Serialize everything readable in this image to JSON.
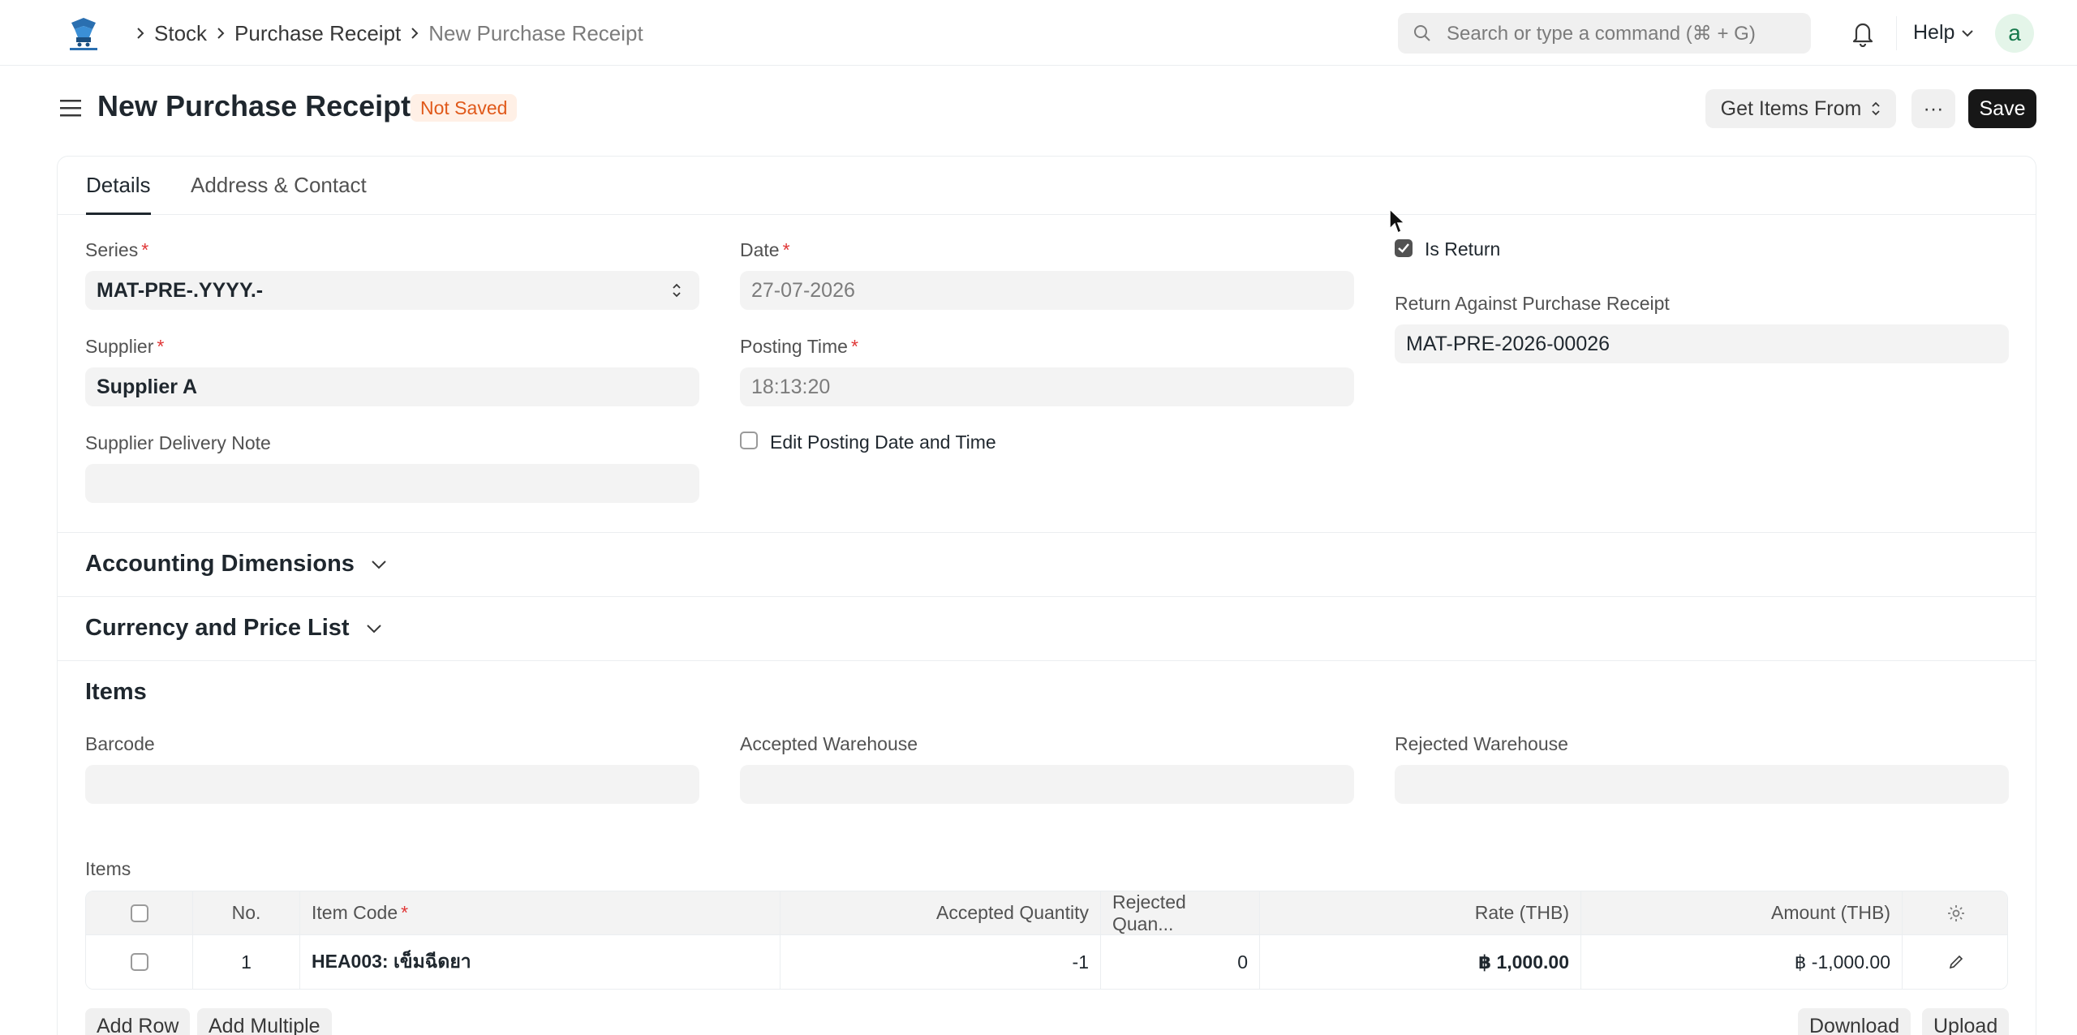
{
  "navbar": {
    "breadcrumbs": [
      "Stock",
      "Purchase Receipt",
      "New Purchase Receipt"
    ],
    "search_placeholder": "Search or type a command (⌘ + G)",
    "help_label": "Help",
    "avatar_initial": "a"
  },
  "page": {
    "title": "New Purchase Receipt",
    "status_badge": "Not Saved",
    "get_items_label": "Get Items From",
    "more_label": "···",
    "save_label": "Save"
  },
  "tabs": [
    "Details",
    "Address & Contact"
  ],
  "details": {
    "series_label": "Series",
    "series_value": "MAT-PRE-.YYYY.-",
    "date_label": "Date",
    "date_value": "27-07-2026",
    "is_return_label": "Is Return",
    "is_return_checked": true,
    "return_against_label": "Return Against Purchase Receipt",
    "return_against_value": "MAT-PRE-2026-00026",
    "supplier_label": "Supplier",
    "supplier_value": "Supplier A",
    "posting_time_label": "Posting Time",
    "posting_time_value": "18:13:20",
    "supplier_delivery_note_label": "Supplier Delivery Note",
    "supplier_delivery_note_value": "",
    "edit_posting_label": "Edit Posting Date and Time",
    "edit_posting_checked": false
  },
  "sections": {
    "accounting_dimensions": "Accounting Dimensions",
    "currency_price_list": "Currency and Price List",
    "items": "Items"
  },
  "items_section": {
    "barcode_label": "Barcode",
    "accepted_warehouse_label": "Accepted Warehouse",
    "rejected_warehouse_label": "Rejected Warehouse",
    "table_label": "Items",
    "columns": [
      "No.",
      "Item Code",
      "Accepted Quantity",
      "Rejected Quan...",
      "Rate (THB)",
      "Amount (THB)"
    ],
    "rows": [
      {
        "no": "1",
        "item_code": "HEA003: เข็มฉีดยา",
        "accepted_qty": "-1",
        "rejected_qty": "0",
        "rate": "฿ 1,000.00",
        "amount": "฿ -1,000.00"
      }
    ],
    "add_row_label": "Add Row",
    "add_multiple_label": "Add Multiple",
    "download_label": "Download",
    "upload_label": "Upload"
  },
  "colors": {
    "primary_button": "#171717",
    "badge_text": "#e0591a",
    "badge_bg": "#fff0e6",
    "required_star": "#e03636"
  }
}
